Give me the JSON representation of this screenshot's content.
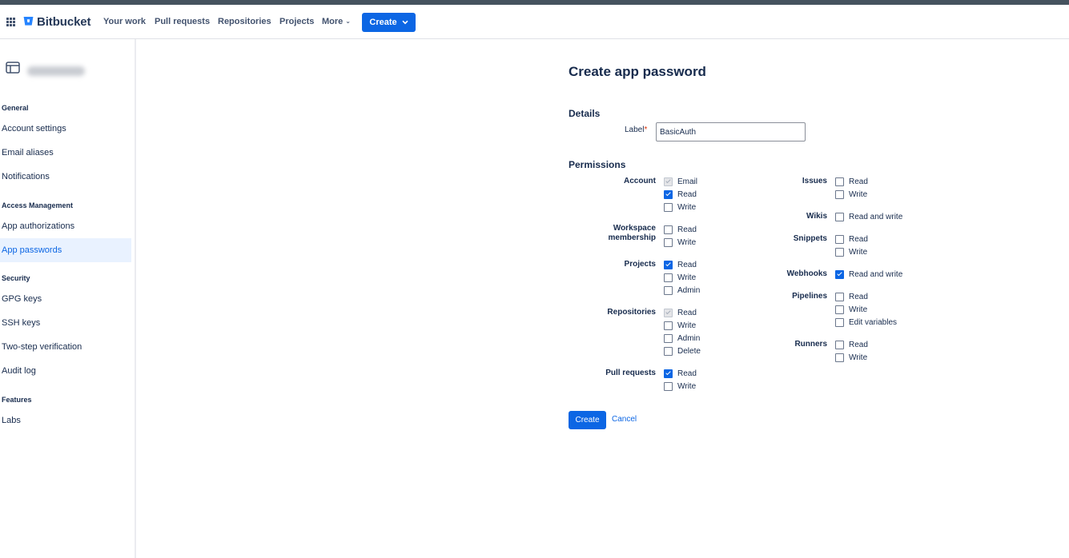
{
  "nav": {
    "brand": "Bitbucket",
    "items": [
      "Your work",
      "Pull requests",
      "Repositories",
      "Projects",
      "More"
    ],
    "create_label": "Create",
    "colors": {
      "accent": "#0c66e4",
      "top_strip": "#45535f"
    }
  },
  "sidebar": {
    "sections": [
      {
        "title": "General",
        "items": [
          "Account settings",
          "Email aliases",
          "Notifications"
        ]
      },
      {
        "title": "Access Management",
        "items": [
          "App authorizations",
          "App passwords"
        ]
      },
      {
        "title": "Security",
        "items": [
          "GPG keys",
          "SSH keys",
          "Two-step verification",
          "Audit log"
        ]
      },
      {
        "title": "Features",
        "items": [
          "Labs"
        ]
      }
    ],
    "active": "App passwords"
  },
  "form": {
    "title": "Create app password",
    "details_heading": "Details",
    "label_label": "Label",
    "label_value": "BasicAuth",
    "permissions_heading": "Permissions",
    "left_groups": [
      {
        "name": "Account",
        "options": [
          {
            "label": "Email",
            "state": "checked-disabled"
          },
          {
            "label": "Read",
            "state": "checked"
          },
          {
            "label": "Write",
            "state": "unchecked"
          }
        ]
      },
      {
        "name": "Workspace membership",
        "options": [
          {
            "label": "Read",
            "state": "unchecked"
          },
          {
            "label": "Write",
            "state": "unchecked"
          }
        ]
      },
      {
        "name": "Projects",
        "options": [
          {
            "label": "Read",
            "state": "checked"
          },
          {
            "label": "Write",
            "state": "unchecked"
          },
          {
            "label": "Admin",
            "state": "unchecked"
          }
        ]
      },
      {
        "name": "Repositories",
        "options": [
          {
            "label": "Read",
            "state": "checked-disabled"
          },
          {
            "label": "Write",
            "state": "unchecked"
          },
          {
            "label": "Admin",
            "state": "unchecked"
          },
          {
            "label": "Delete",
            "state": "unchecked"
          }
        ]
      },
      {
        "name": "Pull requests",
        "options": [
          {
            "label": "Read",
            "state": "checked"
          },
          {
            "label": "Write",
            "state": "unchecked"
          }
        ]
      }
    ],
    "right_groups": [
      {
        "name": "Issues",
        "options": [
          {
            "label": "Read",
            "state": "unchecked"
          },
          {
            "label": "Write",
            "state": "unchecked"
          }
        ]
      },
      {
        "name": "Wikis",
        "options": [
          {
            "label": "Read and write",
            "state": "unchecked"
          }
        ]
      },
      {
        "name": "Snippets",
        "options": [
          {
            "label": "Read",
            "state": "unchecked"
          },
          {
            "label": "Write",
            "state": "unchecked"
          }
        ]
      },
      {
        "name": "Webhooks",
        "options": [
          {
            "label": "Read and write",
            "state": "checked"
          }
        ]
      },
      {
        "name": "Pipelines",
        "options": [
          {
            "label": "Read",
            "state": "unchecked"
          },
          {
            "label": "Write",
            "state": "unchecked"
          },
          {
            "label": "Edit variables",
            "state": "unchecked"
          }
        ]
      },
      {
        "name": "Runners",
        "options": [
          {
            "label": "Read",
            "state": "unchecked"
          },
          {
            "label": "Write",
            "state": "unchecked"
          }
        ]
      }
    ],
    "create_button": "Create",
    "cancel_button": "Cancel"
  }
}
